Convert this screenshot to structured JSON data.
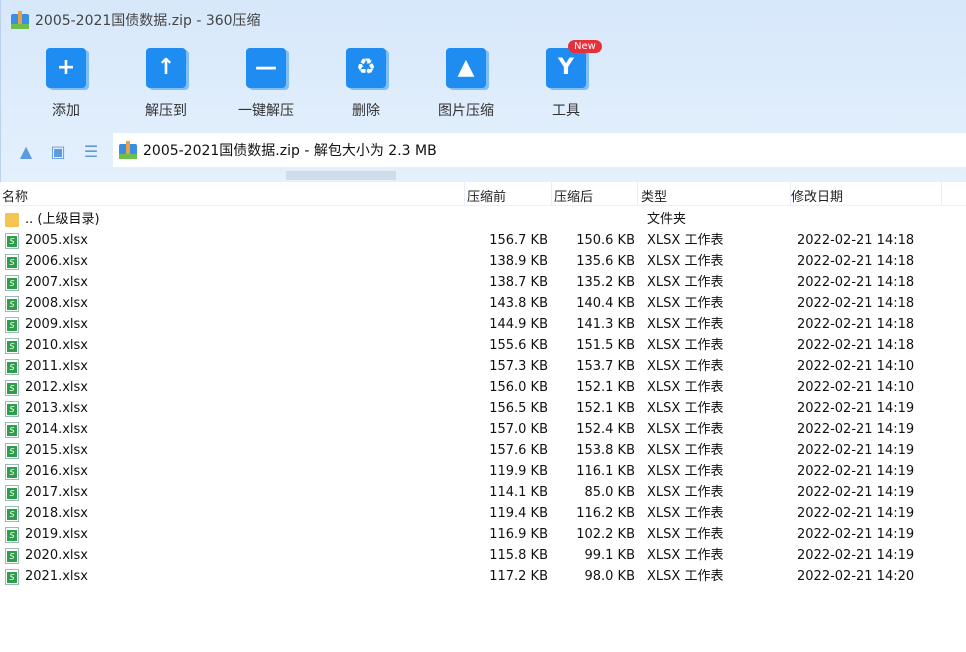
{
  "window": {
    "title": "2005-2021国债数据.zip - 360压缩"
  },
  "toolbar": [
    {
      "label": "添加",
      "icon": "add-folder-icon",
      "glyph": "+"
    },
    {
      "label": "解压到",
      "icon": "extract-to-icon",
      "glyph": "↑"
    },
    {
      "label": "一键解压",
      "icon": "one-click-extract-icon",
      "glyph": "—"
    },
    {
      "label": "删除",
      "icon": "recycle-bin-icon",
      "glyph": "♻"
    },
    {
      "label": "图片压缩",
      "icon": "image-compress-icon",
      "glyph": "▲"
    },
    {
      "label": "工具",
      "icon": "tools-icon",
      "glyph": "Y"
    }
  ],
  "new_badge": "New",
  "address": "2005-2021国债数据.zip - 解包大小为 2.3 MB",
  "columns": {
    "name": "名称",
    "size": "压缩前",
    "packed": "压缩后",
    "type": "类型",
    "date": "修改日期"
  },
  "parent": {
    "name": ".. (上级目录)",
    "type": "文件夹"
  },
  "files": [
    {
      "name": "2005.xlsx",
      "size": "156.7 KB",
      "packed": "150.6 KB",
      "type": "XLSX 工作表",
      "date": "2022-02-21 14:18"
    },
    {
      "name": "2006.xlsx",
      "size": "138.9 KB",
      "packed": "135.6 KB",
      "type": "XLSX 工作表",
      "date": "2022-02-21 14:18"
    },
    {
      "name": "2007.xlsx",
      "size": "138.7 KB",
      "packed": "135.2 KB",
      "type": "XLSX 工作表",
      "date": "2022-02-21 14:18"
    },
    {
      "name": "2008.xlsx",
      "size": "143.8 KB",
      "packed": "140.4 KB",
      "type": "XLSX 工作表",
      "date": "2022-02-21 14:18"
    },
    {
      "name": "2009.xlsx",
      "size": "144.9 KB",
      "packed": "141.3 KB",
      "type": "XLSX 工作表",
      "date": "2022-02-21 14:18"
    },
    {
      "name": "2010.xlsx",
      "size": "155.6 KB",
      "packed": "151.5 KB",
      "type": "XLSX 工作表",
      "date": "2022-02-21 14:18"
    },
    {
      "name": "2011.xlsx",
      "size": "157.3 KB",
      "packed": "153.7 KB",
      "type": "XLSX 工作表",
      "date": "2022-02-21 14:10"
    },
    {
      "name": "2012.xlsx",
      "size": "156.0 KB",
      "packed": "152.1 KB",
      "type": "XLSX 工作表",
      "date": "2022-02-21 14:10"
    },
    {
      "name": "2013.xlsx",
      "size": "156.5 KB",
      "packed": "152.1 KB",
      "type": "XLSX 工作表",
      "date": "2022-02-21 14:19"
    },
    {
      "name": "2014.xlsx",
      "size": "157.0 KB",
      "packed": "152.4 KB",
      "type": "XLSX 工作表",
      "date": "2022-02-21 14:19"
    },
    {
      "name": "2015.xlsx",
      "size": "157.6 KB",
      "packed": "153.8 KB",
      "type": "XLSX 工作表",
      "date": "2022-02-21 14:19"
    },
    {
      "name": "2016.xlsx",
      "size": "119.9 KB",
      "packed": "116.1 KB",
      "type": "XLSX 工作表",
      "date": "2022-02-21 14:19"
    },
    {
      "name": "2017.xlsx",
      "size": "114.1 KB",
      "packed": "85.0 KB",
      "type": "XLSX 工作表",
      "date": "2022-02-21 14:19"
    },
    {
      "name": "2018.xlsx",
      "size": "119.4 KB",
      "packed": "116.2 KB",
      "type": "XLSX 工作表",
      "date": "2022-02-21 14:19"
    },
    {
      "name": "2019.xlsx",
      "size": "116.9 KB",
      "packed": "102.2 KB",
      "type": "XLSX 工作表",
      "date": "2022-02-21 14:19"
    },
    {
      "name": "2020.xlsx",
      "size": "115.8 KB",
      "packed": "99.1 KB",
      "type": "XLSX 工作表",
      "date": "2022-02-21 14:19"
    },
    {
      "name": "2021.xlsx",
      "size": "117.2 KB",
      "packed": "98.0 KB",
      "type": "XLSX 工作表",
      "date": "2022-02-21 14:20"
    }
  ]
}
